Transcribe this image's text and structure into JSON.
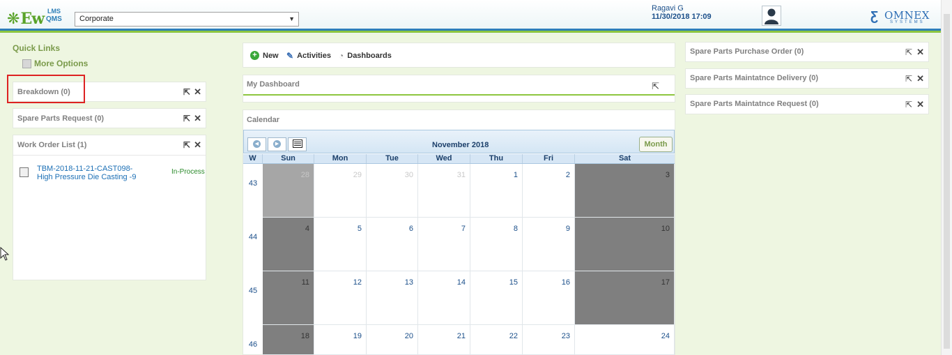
{
  "header": {
    "app_logo": {
      "main": "Ew",
      "sup": "LMS",
      "sub": "QMS"
    },
    "site_select": {
      "value": "Corporate",
      "caret": "▼"
    },
    "user": {
      "name": "Ragavi G",
      "datetime": "11/30/2018 17:09"
    },
    "company_logo": {
      "name": "OMNEX",
      "tagline": "SYSTEMS"
    }
  },
  "quick_links": {
    "title": "Quick Links",
    "more_options": "More Options"
  },
  "left_widgets": [
    {
      "title": "Breakdown (0)"
    },
    {
      "title": "Spare Parts Request (0)"
    },
    {
      "title": "Work Order List (1)"
    }
  ],
  "work_order": {
    "line1": "TBM-2018-11-21-CAST098-",
    "line2": "High Pressure Die Casting -9",
    "status": "In-Process"
  },
  "actions": {
    "new": "New",
    "activities": "Activities",
    "dashboards": "Dashboards"
  },
  "my_dashboard": {
    "title": "My Dashboard"
  },
  "calendar": {
    "title": "Calendar",
    "month_title": "November 2018",
    "view_button": "Month",
    "week_header": "W",
    "days": [
      "Sun",
      "Mon",
      "Tue",
      "Wed",
      "Thu",
      "Fri",
      "Sat"
    ],
    "weeks": [
      {
        "week": "43",
        "dates": [
          "28",
          "29",
          "30",
          "31",
          "1",
          "2",
          "3"
        ]
      },
      {
        "week": "44",
        "dates": [
          "4",
          "5",
          "6",
          "7",
          "8",
          "9",
          "10"
        ]
      },
      {
        "week": "45",
        "dates": [
          "11",
          "12",
          "13",
          "14",
          "15",
          "16",
          "17"
        ]
      },
      {
        "week": "46",
        "dates": [
          "18",
          "19",
          "20",
          "21",
          "22",
          "23",
          "24"
        ]
      }
    ]
  },
  "right_widgets": [
    {
      "title": "Spare Parts Purchase Order (0)"
    },
    {
      "title": "Spare Parts Maintatnce Delivery (0)"
    },
    {
      "title": "Spare Parts Maintatnce Request (0)"
    }
  ],
  "icons": {
    "popout": "⇱",
    "close": "✕"
  },
  "colors": {
    "header_blue": "#2e7fb8",
    "header_green": "#8dc63f",
    "page_bg": "#eef6e1",
    "weekend": "#7f7f7f",
    "link": "#1b6fb5",
    "status_green": "#2a8a2a",
    "highlight": "#dd2222"
  }
}
